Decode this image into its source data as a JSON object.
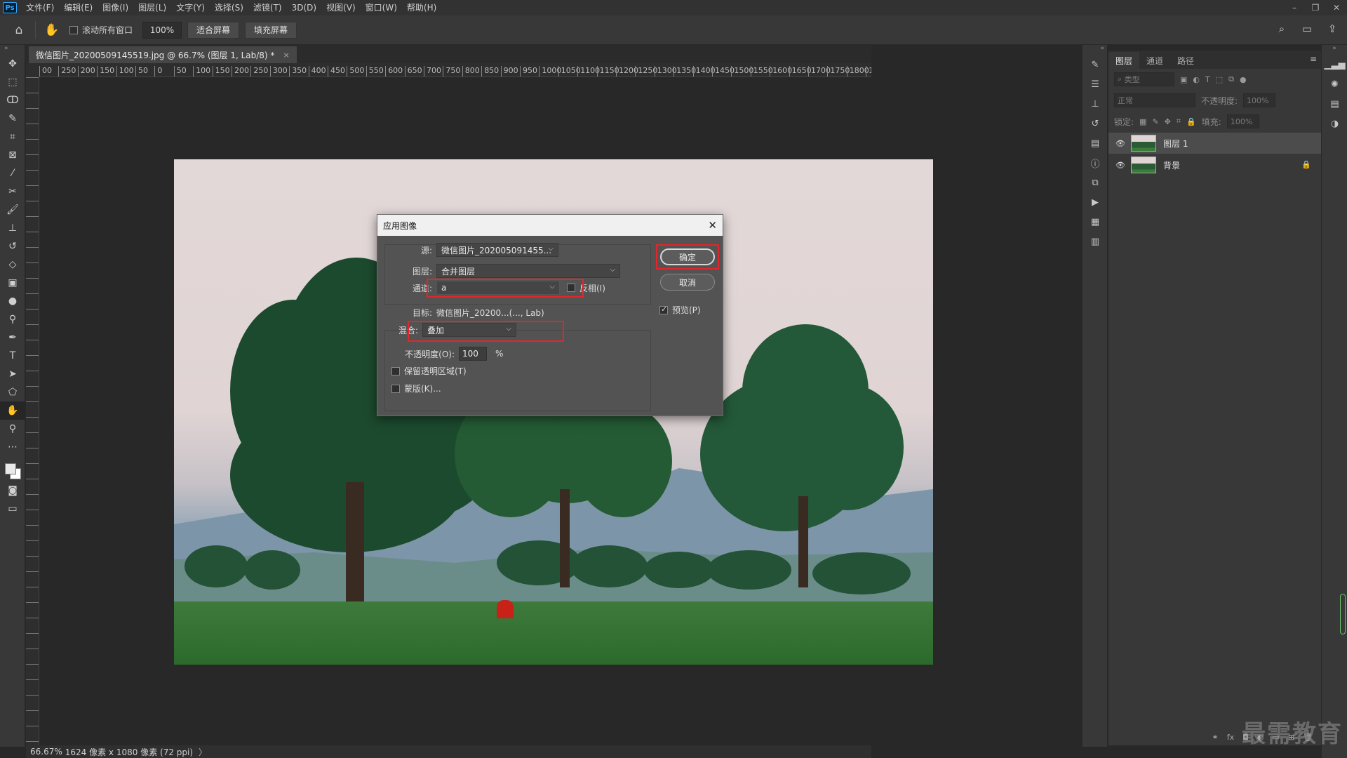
{
  "app": {
    "logo": "Ps"
  },
  "menu": [
    "文件(F)",
    "编辑(E)",
    "图像(I)",
    "图层(L)",
    "文字(Y)",
    "选择(S)",
    "滤镜(T)",
    "3D(D)",
    "视图(V)",
    "窗口(W)",
    "帮助(H)"
  ],
  "window_controls": {
    "minimize": "–",
    "restore": "❐",
    "close": "✕"
  },
  "options": {
    "scroll_all_label": "滚动所有窗口",
    "scroll_all_checked": false,
    "zoom_value": "100%",
    "fit_screen": "适合屏幕",
    "fill_screen": "填充屏幕"
  },
  "document": {
    "tab_title": "微信图片_20200509145519.jpg @ 66.7% (图层 1, Lab/8) *",
    "close": "×"
  },
  "ruler_h": [
    "00",
    "250",
    "200",
    "150",
    "100",
    "50",
    "0",
    "50",
    "100",
    "150",
    "200",
    "250",
    "300",
    "350",
    "400",
    "450",
    "500",
    "550",
    "600",
    "650",
    "700",
    "750",
    "800",
    "850",
    "900",
    "950",
    "1000",
    "1050",
    "1100",
    "1150",
    "1200",
    "1250",
    "1300",
    "1350",
    "1400",
    "1450",
    "1500",
    "1550",
    "1600",
    "1650",
    "1700",
    "1750",
    "1800",
    "1850"
  ],
  "dialog": {
    "title": "应用图像",
    "close": "✕",
    "source_label": "源:",
    "source_value": "微信图片_202005091455...",
    "layer_label": "图层:",
    "layer_value": "合并图层",
    "channel_label": "通道:",
    "channel_value": "a",
    "invert_label": "反相(I)",
    "invert_checked": false,
    "target_label": "目标:",
    "target_value": "微信图片_20200...(..., Lab)",
    "blend_label": "混合:",
    "blend_value": "叠加",
    "opacity_label": "不透明度(O):",
    "opacity_value": "100",
    "opacity_unit": "%",
    "preserve_label": "保留透明区域(T)",
    "preserve_checked": false,
    "mask_label": "蒙版(K)...",
    "mask_checked": false,
    "ok": "确定",
    "cancel": "取消",
    "preview_label": "预览(P)",
    "preview_checked": true,
    "highlight_color": "#e3262b"
  },
  "layers_panel": {
    "tabs": [
      "图层",
      "通道",
      "路径"
    ],
    "active_tab": "图层",
    "filter_placeholder": "类型",
    "blend_mode": "正常",
    "opacity_label": "不透明度:",
    "opacity_value": "100%",
    "lock_label": "锁定:",
    "fill_label": "填充:",
    "fill_value": "100%",
    "layers": [
      {
        "name": "图层 1",
        "selected": true,
        "locked": false
      },
      {
        "name": "背景",
        "selected": false,
        "locked": true
      }
    ]
  },
  "status": {
    "zoom": "66.67%",
    "info": "1624 像素 x 1080 像素 (72 ppi)"
  },
  "watermark": "最需教育"
}
